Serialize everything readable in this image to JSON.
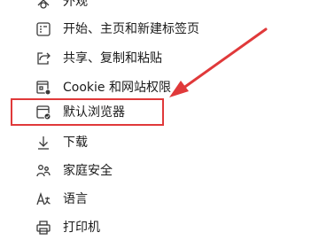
{
  "settings_menu": {
    "items": [
      {
        "label": "外观",
        "icon": "appearance-icon"
      },
      {
        "label": "开始、主页和新建标签页",
        "icon": "start-home-newtab-icon"
      },
      {
        "label": "共享、复制和粘贴",
        "icon": "share-icon"
      },
      {
        "label": "Cookie 和网站权限",
        "icon": "cookie-site-permissions-icon"
      },
      {
        "label": "默认浏览器",
        "icon": "default-browser-icon"
      },
      {
        "label": "下载",
        "icon": "download-icon"
      },
      {
        "label": "家庭安全",
        "icon": "family-safety-icon"
      },
      {
        "label": "语言",
        "icon": "language-icon"
      },
      {
        "label": "打印机",
        "icon": "printer-icon"
      }
    ]
  },
  "annotation": {
    "highlight_color": "#e0393a",
    "highlighted_item": "默认浏览器"
  }
}
